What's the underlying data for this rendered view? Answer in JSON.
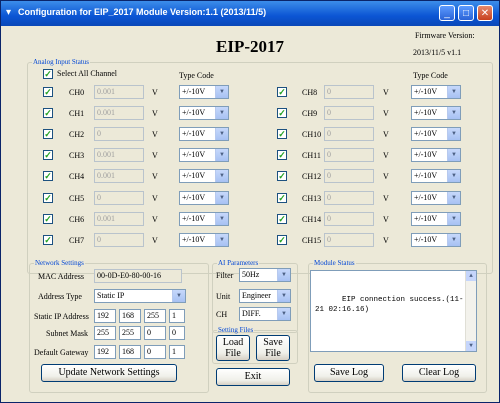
{
  "window": {
    "title": "Configuration for EIP_2017 Module Version:1.1 (2013/11/5)"
  },
  "header": {
    "title": "EIP-2017",
    "firmware_label": "Firmware Version:",
    "firmware_value": "2013/11/5 v1.1"
  },
  "analog": {
    "group_label": "Analog Input Status",
    "select_all_label": "Select All Channel",
    "type_code_label": "Type Code",
    "unit": "V",
    "channels_left": [
      {
        "name": "CH0",
        "value": "0.001",
        "type": "+/-10V",
        "enabled": true
      },
      {
        "name": "CH1",
        "value": "0.001",
        "type": "+/-10V",
        "enabled": true
      },
      {
        "name": "CH2",
        "value": "0",
        "type": "+/-10V",
        "enabled": true
      },
      {
        "name": "CH3",
        "value": "0.001",
        "type": "+/-10V",
        "enabled": true
      },
      {
        "name": "CH4",
        "value": "0.001",
        "type": "+/-10V",
        "enabled": true
      },
      {
        "name": "CH5",
        "value": "0",
        "type": "+/-10V",
        "enabled": true
      },
      {
        "name": "CH6",
        "value": "0.001",
        "type": "+/-10V",
        "enabled": true
      },
      {
        "name": "CH7",
        "value": "0",
        "type": "+/-10V",
        "enabled": true
      }
    ],
    "channels_right": [
      {
        "name": "CH8",
        "value": "0",
        "type": "+/-10V",
        "enabled": true
      },
      {
        "name": "CH9",
        "value": "0",
        "type": "+/-10V",
        "enabled": true
      },
      {
        "name": "CH10",
        "value": "0",
        "type": "+/-10V",
        "enabled": true
      },
      {
        "name": "CH11",
        "value": "0",
        "type": "+/-10V",
        "enabled": true
      },
      {
        "name": "CH12",
        "value": "0",
        "type": "+/-10V",
        "enabled": true
      },
      {
        "name": "CH13",
        "value": "0",
        "type": "+/-10V",
        "enabled": true
      },
      {
        "name": "CH14",
        "value": "0",
        "type": "+/-10V",
        "enabled": true
      },
      {
        "name": "CH15",
        "value": "0",
        "type": "+/-10V",
        "enabled": true
      }
    ]
  },
  "network": {
    "group_label": "Network Settings",
    "mac_label": "MAC Address",
    "mac_value": "00-0D-E0-80-00-16",
    "addr_type_label": "Address Type",
    "addr_type_value": "Static IP",
    "ip_label": "Static IP Address",
    "ip": [
      "192",
      "168",
      "255",
      "1"
    ],
    "mask_label": "Subnet Mask",
    "mask": [
      "255",
      "255",
      "0",
      "0"
    ],
    "gw_label": "Default Gateway",
    "gw": [
      "192",
      "168",
      "0",
      "1"
    ],
    "update_button": "Update Network Settings"
  },
  "ai_params": {
    "group_label": "AI Parameters",
    "filter_label": "Filter",
    "filter_value": "50Hz",
    "unit_label": "Unit",
    "unit_value": "Engineer",
    "ch_label": "CH",
    "ch_value": "DIFF."
  },
  "setting_files": {
    "group_label": "Setting Files",
    "load_line1": "Load",
    "load_line2": "File",
    "save_line1": "Save",
    "save_line2": "File",
    "exit_label": "Exit"
  },
  "module_status": {
    "group_label": "Module Status",
    "message": "EIP connection success.(11-21 02:16.16)",
    "save_log": "Save Log",
    "clear_log": "Clear Log"
  },
  "icons": {
    "check": "check-icon",
    "dropdown": "chevron-down-icon",
    "minimize": "minimize-icon",
    "maximize": "maximize-icon",
    "close": "close-icon",
    "app": "app-icon"
  }
}
